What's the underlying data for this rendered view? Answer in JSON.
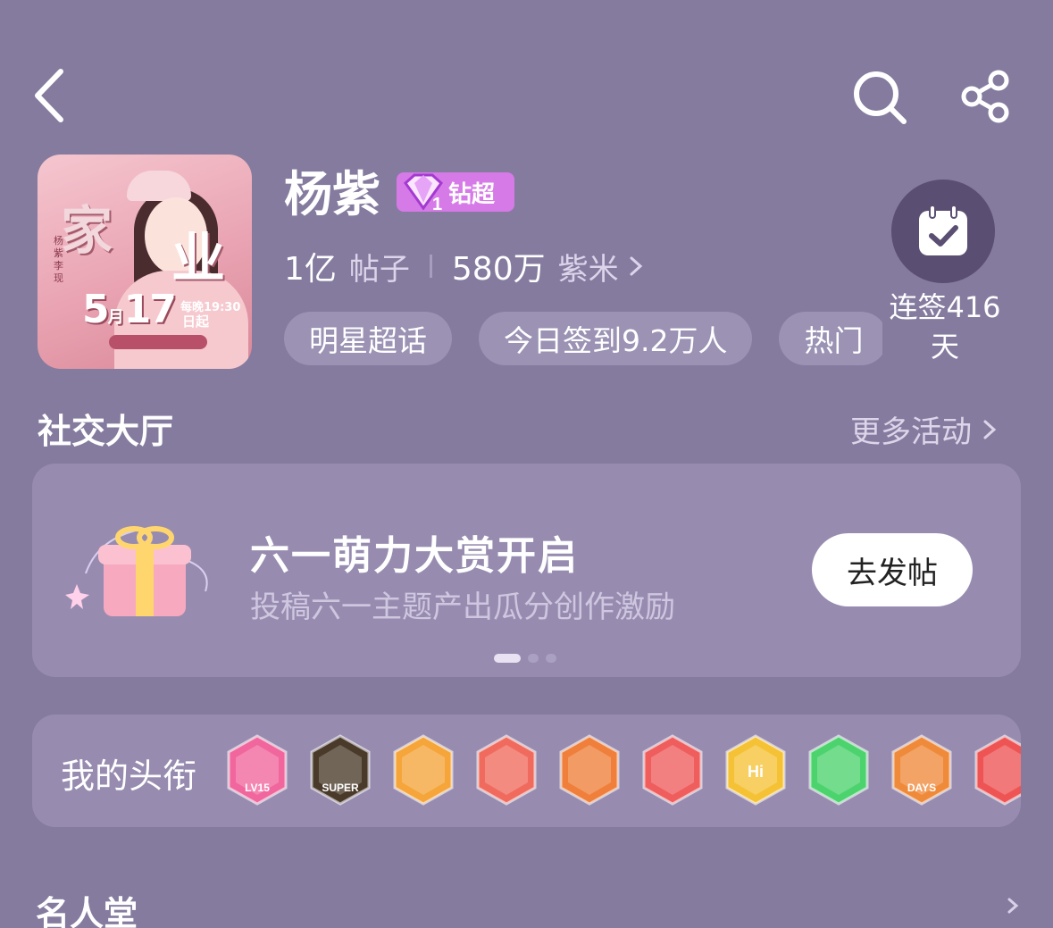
{
  "header": {
    "back_icon": "chevron-left-icon",
    "search_icon": "search-icon",
    "share_icon": "share-icon"
  },
  "cover": {
    "title_left": "家",
    "title_right": "业",
    "date": "5",
    "date_month": "月",
    "date_day": "17",
    "date_suffix": "日起",
    "time": "每晚19:30"
  },
  "profile": {
    "name": "杨紫",
    "badge_level": "1",
    "badge_label": "钻超",
    "posts_count": "1亿",
    "posts_label": "帖子",
    "fans_count": "580万",
    "fans_label": "紫米",
    "tags": [
      "明星超话",
      "今日签到9.2万人",
      "热门"
    ]
  },
  "signin": {
    "icon": "calendar-check-icon",
    "label": "连签416天"
  },
  "social": {
    "title": "社交大厅",
    "more": "更多活动"
  },
  "banner": {
    "title": "六一萌力大赏开启",
    "subtitle": "投稿六一主题产出瓜分创作激励",
    "button": "去发帖",
    "page_count": 3,
    "active_page": 0
  },
  "my_titles": {
    "label": "我的头衔",
    "badges": [
      {
        "name": "lv15-badge",
        "text": "LV15",
        "color": "#f0669d"
      },
      {
        "name": "super-crown-badge",
        "text": "SUPER",
        "color": "#4a3a2a"
      },
      {
        "name": "crown-badge",
        "text": "",
        "color": "#f5a53a"
      },
      {
        "name": "dragon-badge",
        "text": "",
        "color": "#f06b5e"
      },
      {
        "name": "dragon-gold-badge",
        "text": "",
        "color": "#ef7f3a"
      },
      {
        "name": "rabbit-badge",
        "text": "",
        "color": "#ef5d5d"
      },
      {
        "name": "hi-badge",
        "text": "Hi",
        "color": "#f5c236"
      },
      {
        "name": "hand-badge",
        "text": "",
        "color": "#4cd36e"
      },
      {
        "name": "100-days-badge",
        "text": "DAYS",
        "color": "#ef8a3a"
      },
      {
        "name": "trophy-badge",
        "text": "",
        "color": "#ef5454"
      }
    ]
  },
  "hall": {
    "title": "名人堂"
  }
}
